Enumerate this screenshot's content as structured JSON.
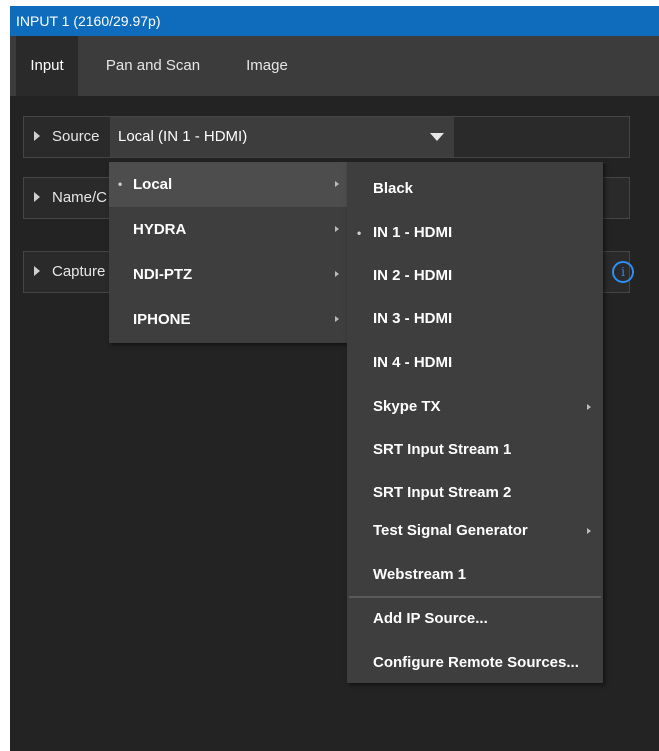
{
  "window": {
    "title": "INPUT 1 (2160/29.97p)"
  },
  "tabs": [
    {
      "label": "Input",
      "active": true
    },
    {
      "label": "Pan and Scan",
      "active": false
    },
    {
      "label": "Image",
      "active": false
    }
  ],
  "sections": {
    "source": {
      "label": "Source",
      "value": "Local (IN 1 - HDMI)"
    },
    "name": {
      "label": "Name/C"
    },
    "capture": {
      "label": "Capture"
    }
  },
  "icons": {
    "info": "info-icon",
    "info_glyph": "i",
    "bullet_glyph": "•"
  },
  "colors": {
    "titlebar": "#0f6cbd",
    "accent": "#2f8ef2",
    "menu_bg": "#3e3e3e",
    "panel_bg": "#232323"
  },
  "source_menu": {
    "items": [
      {
        "label": "Local",
        "selected": true,
        "has_submenu": true
      },
      {
        "label": "HYDRA",
        "selected": false,
        "has_submenu": true
      },
      {
        "label": "NDI-PTZ",
        "selected": false,
        "has_submenu": true
      },
      {
        "label": "IPHONE",
        "selected": false,
        "has_submenu": true
      }
    ]
  },
  "local_submenu": {
    "items": [
      {
        "label": "Black"
      },
      {
        "label": "IN 1 - HDMI",
        "selected": true
      },
      {
        "label": "IN 2 - HDMI"
      },
      {
        "label": "IN 3 - HDMI"
      },
      {
        "label": "IN 4 - HDMI"
      },
      {
        "label": "Skype TX",
        "has_submenu": true
      },
      {
        "label": "SRT Input Stream 1"
      },
      {
        "label": "SRT Input Stream 2"
      },
      {
        "label": "Test Signal Generator",
        "has_submenu": true
      },
      {
        "label": "Webstream 1"
      },
      {
        "label": "Add IP Source..."
      },
      {
        "label": "Configure Remote Sources..."
      }
    ]
  }
}
